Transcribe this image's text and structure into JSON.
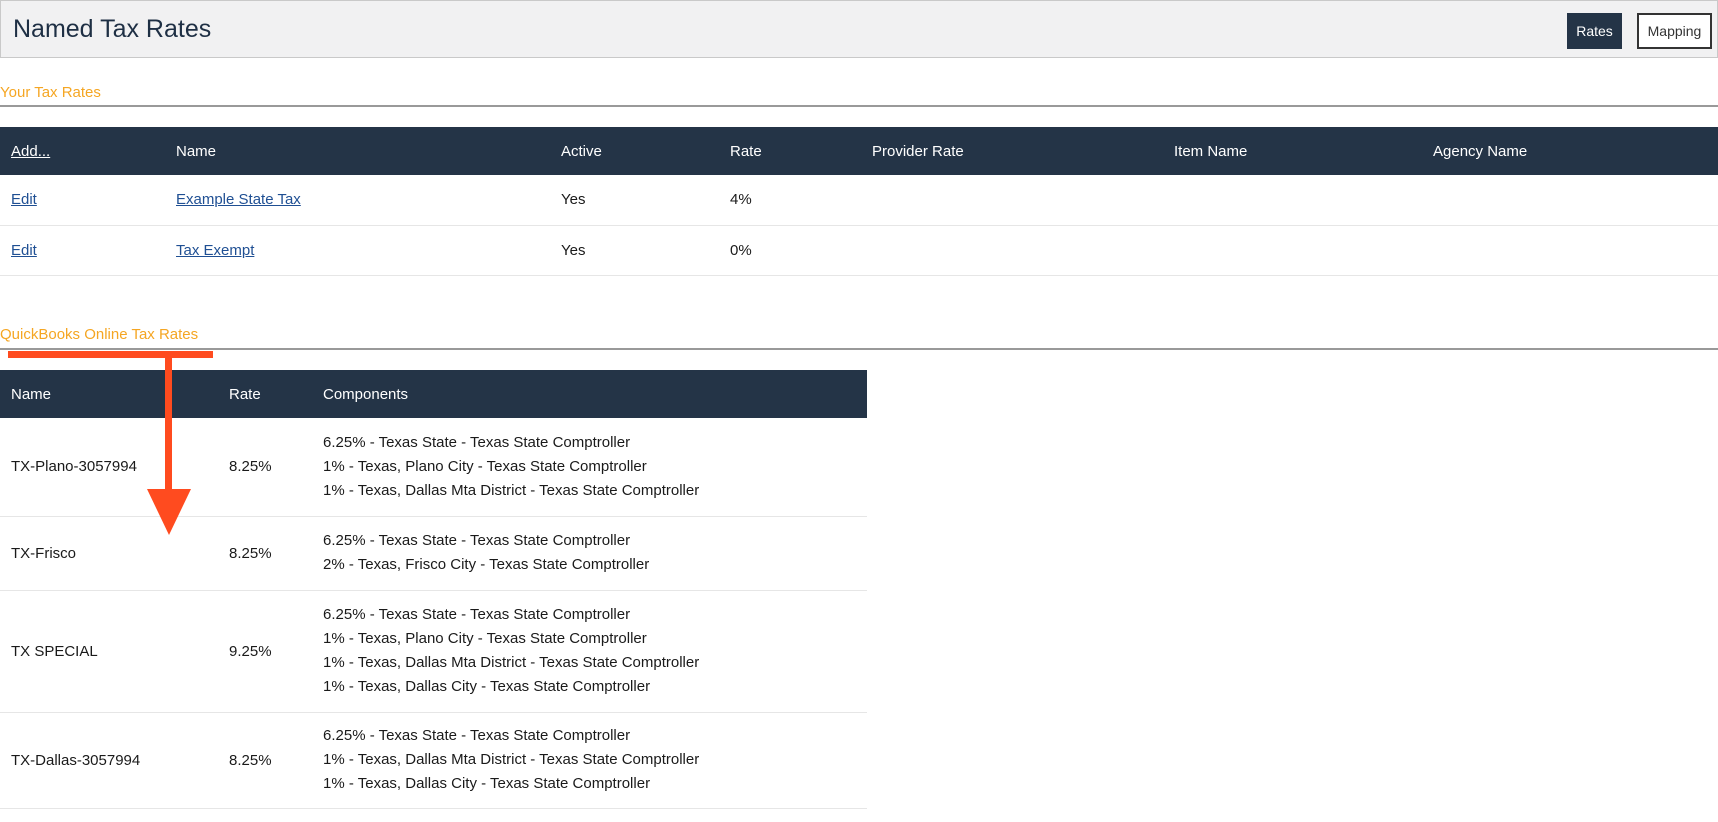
{
  "header": {
    "title": "Named Tax Rates",
    "rates_label": "Rates",
    "mapping_label": "Mapping"
  },
  "your_rates": {
    "section_title": "Your Tax Rates",
    "columns": [
      "Add...",
      "Name",
      "Active",
      "Rate",
      "Provider Rate",
      "Item Name",
      "Agency Name"
    ],
    "rows": [
      {
        "action": "Edit",
        "name": "Example State Tax",
        "active": "Yes",
        "rate": "4%",
        "provider_rate": "",
        "item_name": "",
        "agency_name": ""
      },
      {
        "action": "Edit",
        "name": "Tax Exempt",
        "active": "Yes",
        "rate": "0%",
        "provider_rate": "",
        "item_name": "",
        "agency_name": ""
      }
    ]
  },
  "qbo_rates": {
    "section_title": "QuickBooks Online Tax Rates",
    "columns": [
      "Name",
      "Rate",
      "Components"
    ],
    "rows": [
      {
        "name": "TX-Plano-3057994",
        "rate": "8.25%",
        "components": [
          "6.25% - Texas State - Texas State Comptroller",
          "1% - Texas, Plano City - Texas State Comptroller",
          "1% - Texas, Dallas Mta District - Texas State Comptroller"
        ]
      },
      {
        "name": "TX-Frisco",
        "rate": "8.25%",
        "components": [
          "6.25% - Texas State - Texas State Comptroller",
          "2% - Texas, Frisco City - Texas State Comptroller"
        ]
      },
      {
        "name": "TX SPECIAL",
        "rate": "9.25%",
        "components": [
          "6.25% - Texas State - Texas State Comptroller",
          "1% - Texas, Plano City - Texas State Comptroller",
          "1% - Texas, Dallas Mta District - Texas State Comptroller",
          "1% - Texas, Dallas City - Texas State Comptroller"
        ]
      },
      {
        "name": "TX-Dallas-3057994",
        "rate": "8.25%",
        "components": [
          "6.25% - Texas State - Texas State Comptroller",
          "1% - Texas, Dallas Mta District - Texas State Comptroller",
          "1% - Texas, Dallas City - Texas State Comptroller"
        ]
      }
    ]
  },
  "colors": {
    "header_dark": "#243447",
    "section_accent": "#f5a623",
    "annotation_arrow": "#ff4b1f",
    "link": "#1f4f93"
  },
  "icons": {
    "annotation": "down-arrow-annotation-icon"
  }
}
